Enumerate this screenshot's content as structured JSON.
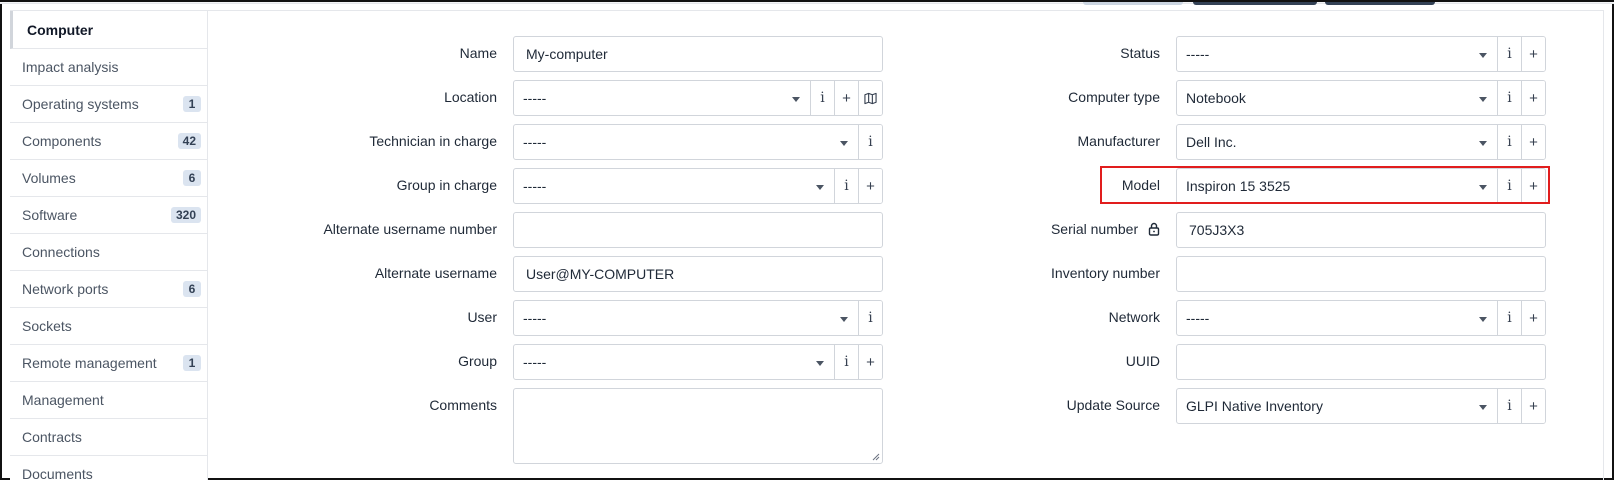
{
  "sidebar": {
    "active_tab": "Computer",
    "items": [
      {
        "label": "Impact analysis",
        "badge": ""
      },
      {
        "label": "Operating systems",
        "badge": "1"
      },
      {
        "label": "Components",
        "badge": "42"
      },
      {
        "label": "Volumes",
        "badge": "6"
      },
      {
        "label": "Software",
        "badge": "320"
      },
      {
        "label": "Connections",
        "badge": ""
      },
      {
        "label": "Network ports",
        "badge": "6"
      },
      {
        "label": "Sockets",
        "badge": ""
      },
      {
        "label": "Remote management",
        "badge": "1"
      },
      {
        "label": "Management",
        "badge": ""
      },
      {
        "label": "Contracts",
        "badge": ""
      },
      {
        "label": "Documents",
        "badge": ""
      }
    ]
  },
  "form_left": {
    "name": {
      "label": "Name",
      "value": "My-computer"
    },
    "location": {
      "label": "Location",
      "value": "-----"
    },
    "technician": {
      "label": "Technician in charge",
      "value": "-----"
    },
    "group_in_charge": {
      "label": "Group in charge",
      "value": "-----"
    },
    "alt_username_number": {
      "label": "Alternate username number",
      "value": ""
    },
    "alt_username": {
      "label": "Alternate username",
      "value": "User@MY-COMPUTER"
    },
    "user": {
      "label": "User",
      "value": "-----"
    },
    "group": {
      "label": "Group",
      "value": "-----"
    },
    "comments": {
      "label": "Comments",
      "value": ""
    }
  },
  "form_right": {
    "status": {
      "label": "Status",
      "value": "-----"
    },
    "computer_type": {
      "label": "Computer type",
      "value": "Notebook"
    },
    "manufacturer": {
      "label": "Manufacturer",
      "value": "Dell Inc."
    },
    "model": {
      "label": "Model",
      "value": "Inspiron 15 3525"
    },
    "serial": {
      "label": "Serial number",
      "value": "705J3X3"
    },
    "inventory": {
      "label": "Inventory number",
      "value": ""
    },
    "network": {
      "label": "Network",
      "value": "-----"
    },
    "uuid": {
      "label": "UUID",
      "value": ""
    },
    "update_source": {
      "label": "Update Source",
      "value": "GLPI Native Inventory"
    }
  },
  "icons": {
    "info": "i",
    "add": "+",
    "map": "map-icon",
    "lock": "lock-icon"
  },
  "colors": {
    "highlight": "#e11d1d",
    "badge_bg": "#dbe4f0",
    "border": "#d1d5db"
  }
}
